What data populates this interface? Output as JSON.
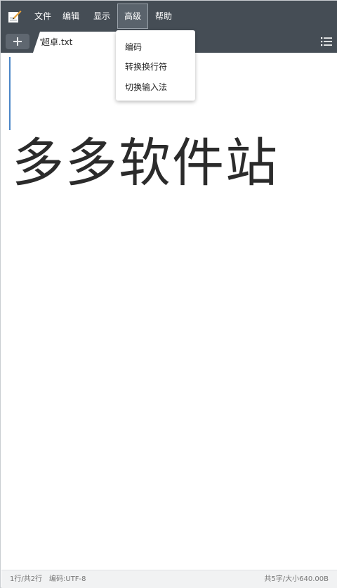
{
  "menubar": {
    "app_icon": "notepad-pen-icon",
    "items": [
      {
        "label": "文件"
      },
      {
        "label": "编辑"
      },
      {
        "label": "显示"
      },
      {
        "label": "高级",
        "active": true
      },
      {
        "label": "帮助"
      }
    ]
  },
  "tabbar": {
    "add_icon": "plus-icon",
    "tabs": [
      {
        "label": "超卓.txt",
        "modified_dot": true
      }
    ],
    "list_icon": "list-icon"
  },
  "dropdown": {
    "items": [
      {
        "label": "编码"
      },
      {
        "label": "转换换行符"
      },
      {
        "label": "切换输入法"
      }
    ]
  },
  "editor": {
    "content": "多多软件站"
  },
  "statusbar": {
    "line_info": "1行/共2行",
    "encoding": "编码:UTF-8",
    "size_info": "共5字/大小640.00B"
  },
  "colors": {
    "toolbar_bg": "#454d55",
    "caret": "#4b86c8",
    "status_bg": "#f1f2f3"
  }
}
